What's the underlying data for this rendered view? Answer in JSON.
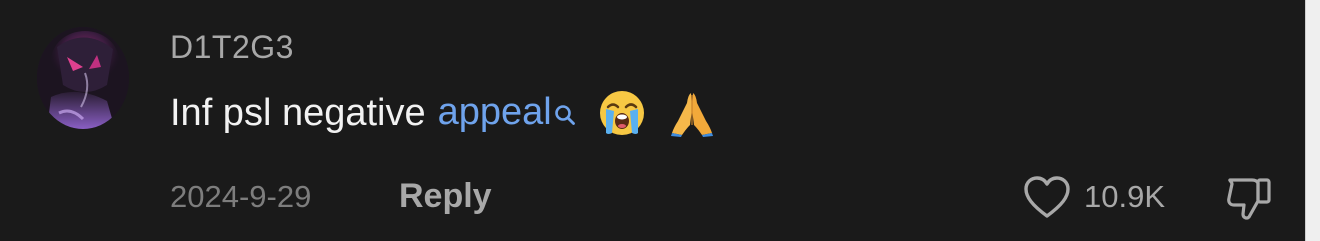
{
  "comment": {
    "username": "D1T2G3",
    "text_plain": "Inf psl negative",
    "search_term": "appeal",
    "emojis": [
      "loudly-crying-face-emoji",
      "folded-hands-emoji"
    ],
    "date": "2024-9-29",
    "reply_label": "Reply",
    "like_count": "10.9K"
  },
  "icons": {
    "search": "search-icon",
    "like": "heart-icon",
    "dislike": "thumbs-down-icon"
  },
  "colors": {
    "background": "#1a1a1a",
    "link": "#6fa3ec",
    "text": "#f2f2f2",
    "muted": "#a8a8a8",
    "date": "#7d7d7d"
  }
}
